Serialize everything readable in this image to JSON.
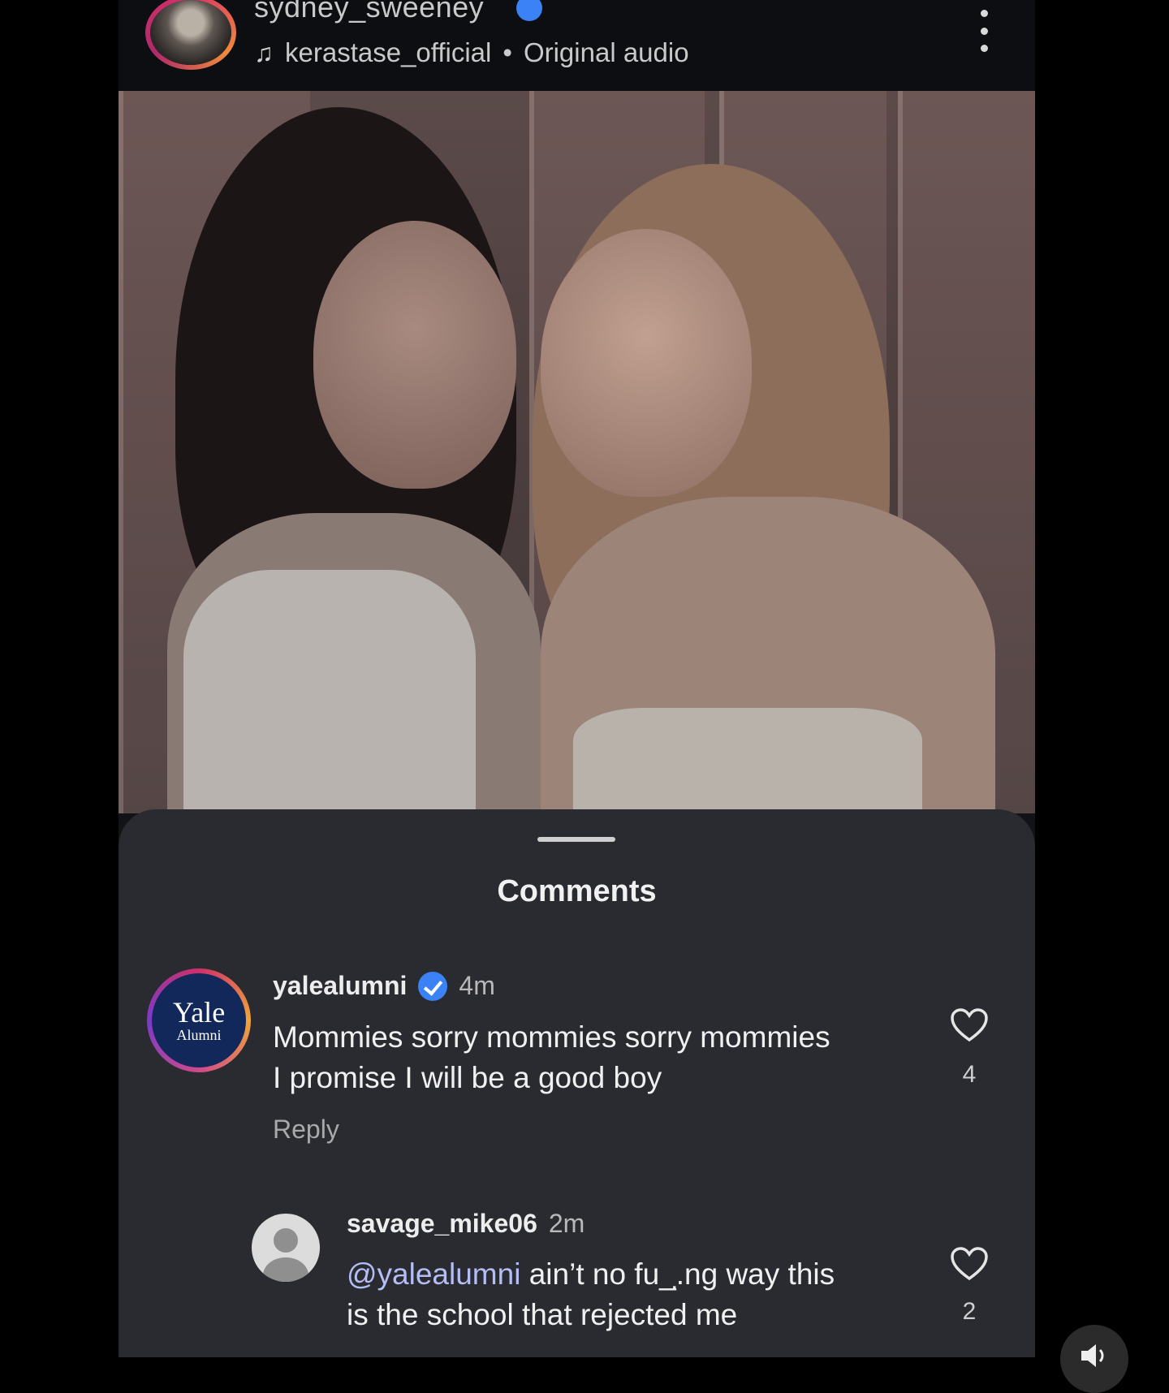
{
  "post": {
    "username": "sydney_sweeney",
    "audio_icon": "music-note-icon",
    "audio_account": "kerastase_official",
    "audio_separator": "•",
    "audio_label": "Original audio"
  },
  "comments_sheet": {
    "title": "Comments",
    "comments": [
      {
        "username": "yalealumni",
        "verified": true,
        "time": "4m",
        "avatar_text": "Yale",
        "avatar_subtext": "Alumni",
        "text_line1": "Mommies sorry mommies sorry mommies",
        "text_line2": "I promise I will be a good boy",
        "reply_label": "Reply",
        "likes": "4"
      },
      {
        "username": "savage_mike06",
        "time": "2m",
        "mention": "@yalealumni",
        "text_line1_rest": " ain’t no fu_.̣ng way this",
        "text_line2": "is the school that rejected me",
        "likes": "2"
      }
    ]
  },
  "colors": {
    "background": "#121317",
    "sheet": "#2a2b31",
    "verified_blue": "#3b82f6",
    "mention": "#b5bdf5"
  }
}
